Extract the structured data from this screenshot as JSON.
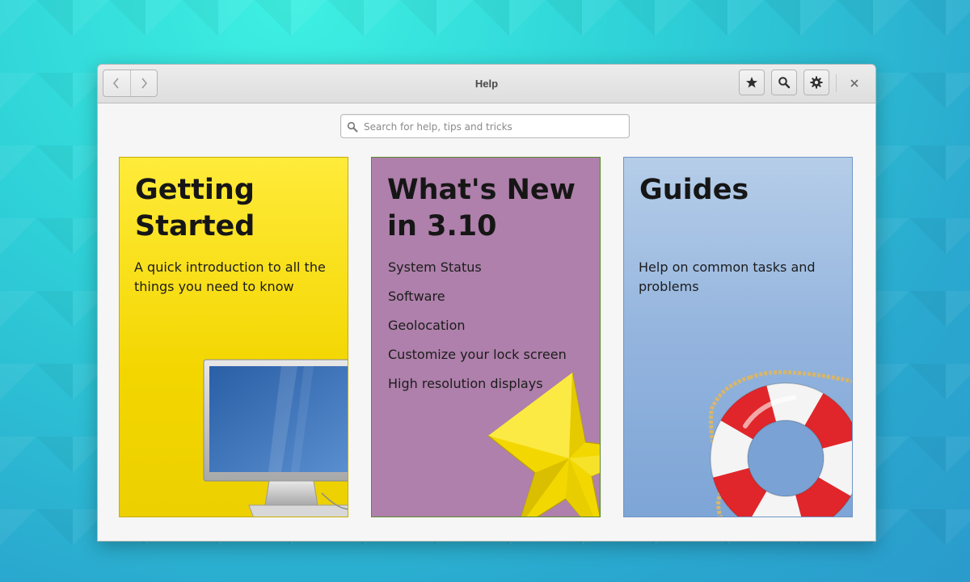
{
  "window": {
    "title": "Help",
    "nav": {
      "back_icon": "chevron-left-icon",
      "forward_icon": "chevron-right-icon"
    },
    "toolbar": {
      "bookmark_icon": "star-icon",
      "search_icon": "search-icon",
      "menu_icon": "gear-icon",
      "close_icon": "close-icon"
    }
  },
  "search": {
    "placeholder": "Search for help, tips and tricks",
    "value": ""
  },
  "cards": [
    {
      "title": "Getting Started",
      "description": "A quick introduction to all the things you need to know",
      "color": "#f3d600",
      "illustration": "computer-monitor"
    },
    {
      "title": "What's New in 3.10",
      "items": [
        "System Status",
        "Software",
        "Geolocation",
        "Customize your lock screen",
        "High resolution displays"
      ],
      "color": "#ae80ab",
      "illustration": "star"
    },
    {
      "title": "Guides",
      "description": "Help on common tasks and problems",
      "color": "#94b4de",
      "illustration": "life-buoy"
    }
  ]
}
